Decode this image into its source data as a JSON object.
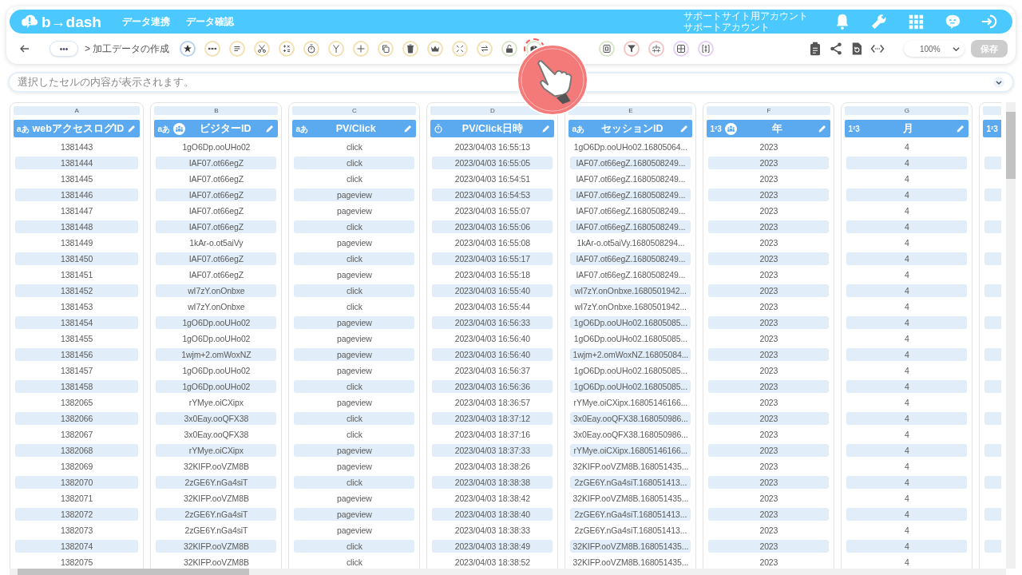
{
  "header": {
    "logo": "b→dash",
    "nav": [
      "データ連携",
      "データ確認"
    ],
    "account": [
      "サポートサイト用アカウント",
      "サポートアカウント"
    ]
  },
  "toolbar": {
    "breadcrumb_more": "•••",
    "breadcrumb": "> 加工データの作成",
    "tools": [
      {
        "kind": "star",
        "color": "#b9d3ec",
        "highlighted": false
      },
      {
        "kind": "dots",
        "color": "#f3e1b3",
        "highlighted": false
      },
      {
        "kind": "lines",
        "color": "#f3e1b3",
        "highlighted": false
      },
      {
        "kind": "scissors",
        "color": "#f3e1b3",
        "highlighted": false
      },
      {
        "kind": "calculator",
        "color": "#f3e1b3",
        "highlighted": false
      },
      {
        "kind": "stopwatch",
        "color": "#f3e1b3",
        "highlighted": false
      },
      {
        "kind": "branch",
        "color": "#f3e1b3",
        "highlighted": false
      },
      {
        "kind": "plus",
        "color": "#f3e1b3",
        "highlighted": false
      },
      {
        "kind": "copy",
        "color": "#f3e1b3",
        "highlighted": false
      },
      {
        "kind": "trash",
        "color": "#f3e1b3",
        "highlighted": false
      },
      {
        "kind": "crown",
        "color": "#f3e1b3",
        "highlighted": false
      },
      {
        "kind": "shrink",
        "color": "#f3e1b3",
        "highlighted": false
      },
      {
        "kind": "swap",
        "color": "#f3e1b3",
        "highlighted": false
      },
      {
        "kind": "lock",
        "color": "#d9e5c9",
        "highlighted": false
      },
      {
        "kind": "box",
        "color": "#d9e5c9",
        "highlighted": true
      }
    ],
    "tools_after_pointer": [
      {
        "kind": "square",
        "color": "#d9e5c9",
        "highlighted": false
      },
      {
        "kind": "filter",
        "color": "#f5c6c6",
        "highlighted": false
      },
      {
        "kind": "hierarchy",
        "color": "#f5c6c6",
        "highlighted": false
      },
      {
        "kind": "grid",
        "color": "#e5cff4",
        "highlighted": false
      },
      {
        "kind": "bracket",
        "color": "#e5cff4",
        "highlighted": false
      }
    ],
    "zoom": "100%",
    "save": {
      "label": "保存",
      "disabled": true
    }
  },
  "cell_bar": {
    "placeholder": "選択したセルの内容が表示されます。"
  },
  "table": {
    "columns": [
      {
        "letter": "A",
        "type_label": "aあ",
        "title": "webアクセスログID",
        "group_icon": false,
        "edit_icon": true
      },
      {
        "letter": "B",
        "type_label": "aあ",
        "title": "ビジターID",
        "group_icon": true,
        "edit_icon": true
      },
      {
        "letter": "C",
        "type_label": "aあ",
        "title": "PV/Click",
        "group_icon": false,
        "edit_icon": true
      },
      {
        "letter": "D",
        "title": "PV/Click日時",
        "group_icon": false,
        "edit_icon": true
      },
      {
        "letter": "E",
        "type_label": "aあ",
        "title": "セッションID",
        "group_icon": false,
        "edit_icon": true
      },
      {
        "letter": "F",
        "type_label": "1²3",
        "title": "年",
        "group_icon": true,
        "edit_icon": true
      },
      {
        "letter": "G",
        "type_label": "1²3",
        "title": "月",
        "group_icon": false,
        "edit_icon": true
      },
      {
        "type_label": "1²3",
        "group_icon": false,
        "edit_icon": false
      }
    ],
    "rows": [
      [
        "1381443",
        "1gO6Dp.ooUHo02",
        "click",
        "2023/04/03 16:55:13",
        "1gO6Dp.ooUHo02.16805064...",
        "2023",
        "4"
      ],
      [
        "1381444",
        "IAF07.ot66egZ",
        "click",
        "2023/04/03 16:55:05",
        "IAF07.ot66egZ.1680508249...",
        "2023",
        "4"
      ],
      [
        "1381445",
        "IAF07.ot66egZ",
        "click",
        "2023/04/03 16:54:51",
        "IAF07.ot66egZ.1680508249...",
        "2023",
        "4"
      ],
      [
        "1381446",
        "IAF07.ot66egZ",
        "pageview",
        "2023/04/03 16:54:53",
        "IAF07.ot66egZ.1680508249...",
        "2023",
        "4"
      ],
      [
        "1381447",
        "IAF07.ot66egZ",
        "pageview",
        "2023/04/03 16:55:07",
        "IAF07.ot66egZ.1680508249...",
        "2023",
        "4"
      ],
      [
        "1381448",
        "IAF07.ot66egZ",
        "click",
        "2023/04/03 16:55:06",
        "IAF07.ot66egZ.1680508249...",
        "2023",
        "4"
      ],
      [
        "1381449",
        "1kAr-o.ot5aiVy",
        "pageview",
        "2023/04/03 16:55:08",
        "1kAr-o.ot5aiVy.1680508294...",
        "2023",
        "4"
      ],
      [
        "1381450",
        "IAF07.ot66egZ",
        "click",
        "2023/04/03 16:55:17",
        "IAF07.ot66egZ.1680508249...",
        "2023",
        "4"
      ],
      [
        "1381451",
        "IAF07.ot66egZ",
        "pageview",
        "2023/04/03 16:55:18",
        "IAF07.ot66egZ.1680508249...",
        "2023",
        "4"
      ],
      [
        "1381452",
        "wI7zY.onOnbxe",
        "click",
        "2023/04/03 16:55:40",
        "wI7zY.onOnbxe.1680501942...",
        "2023",
        "4"
      ],
      [
        "1381453",
        "wI7zY.onOnbxe",
        "click",
        "2023/04/03 16:55:44",
        "wI7zY.onOnbxe.1680501942...",
        "2023",
        "4"
      ],
      [
        "1381454",
        "1gO6Dp.ooUHo02",
        "pageview",
        "2023/04/03 16:56:33",
        "1gO6Dp.ooUHo02.16805085...",
        "2023",
        "4"
      ],
      [
        "1381455",
        "1gO6Dp.ooUHo02",
        "pageview",
        "2023/04/03 16:56:40",
        "1gO6Dp.ooUHo02.16805085...",
        "2023",
        "4"
      ],
      [
        "1381456",
        "1wjm+2.omWoxNZ",
        "pageview",
        "2023/04/03 16:56:40",
        "1wjm+2.omWoxNZ.16805084...",
        "2023",
        "4"
      ],
      [
        "1381457",
        "1gO6Dp.ooUHo02",
        "pageview",
        "2023/04/03 16:56:37",
        "1gO6Dp.ooUHo02.16805085...",
        "2023",
        "4"
      ],
      [
        "1381458",
        "1gO6Dp.ooUHo02",
        "click",
        "2023/04/03 16:56:36",
        "1gO6Dp.ooUHo02.16805085...",
        "2023",
        "4"
      ],
      [
        "1382065",
        "rYMye.oiCXipx",
        "pageview",
        "2023/04/03 18:36:57",
        "rYMye.oiCXipx.16805146166...",
        "2023",
        "4"
      ],
      [
        "1382066",
        "3x0Eay.ooQFX38",
        "click",
        "2023/04/03 18:37:12",
        "3x0Eay.ooQFX38.168050986...",
        "2023",
        "4"
      ],
      [
        "1382067",
        "3x0Eay.ooQFX38",
        "click",
        "2023/04/03 18:37:16",
        "3x0Eay.ooQFX38.168050986...",
        "2023",
        "4"
      ],
      [
        "1382068",
        "rYMye.oiCXipx",
        "pageview",
        "2023/04/03 18:37:33",
        "rYMye.oiCXipx.16805146166...",
        "2023",
        "4"
      ],
      [
        "1382069",
        "32KIFP.ooVZM8B",
        "pageview",
        "2023/04/03 18:38:26",
        "32KIFP.ooVZM8B.168051435...",
        "2023",
        "4"
      ],
      [
        "1382070",
        "2zGE6Y.nGa4siT",
        "click",
        "2023/04/03 18:38:38",
        "2zGE6Y.nGa4siT.168051413...",
        "2023",
        "4"
      ],
      [
        "1382071",
        "32KIFP.ooVZM8B",
        "pageview",
        "2023/04/03 18:38:42",
        "32KIFP.ooVZM8B.168051435...",
        "2023",
        "4"
      ],
      [
        "1382072",
        "2zGE6Y.nGa4siT",
        "pageview",
        "2023/04/03 18:38:40",
        "2zGE6Y.nGa4siT.168051413...",
        "2023",
        "4"
      ],
      [
        "1382073",
        "2zGE6Y.nGa4siT",
        "pageview",
        "2023/04/03 18:38:33",
        "2zGE6Y.nGa4siT.168051413...",
        "2023",
        "4"
      ],
      [
        "1382074",
        "32KIFP.ooVZM8B",
        "click",
        "2023/04/03 18:38:49",
        "32KIFP.ooVZM8B.168051435...",
        "2023",
        "4"
      ],
      [
        "1382075",
        "32KIFP.ooVZM8B",
        "click",
        "2023/04/03 18:38:52",
        "32KIFP.ooVZM8B.168051435...",
        "2023",
        "4"
      ]
    ]
  }
}
